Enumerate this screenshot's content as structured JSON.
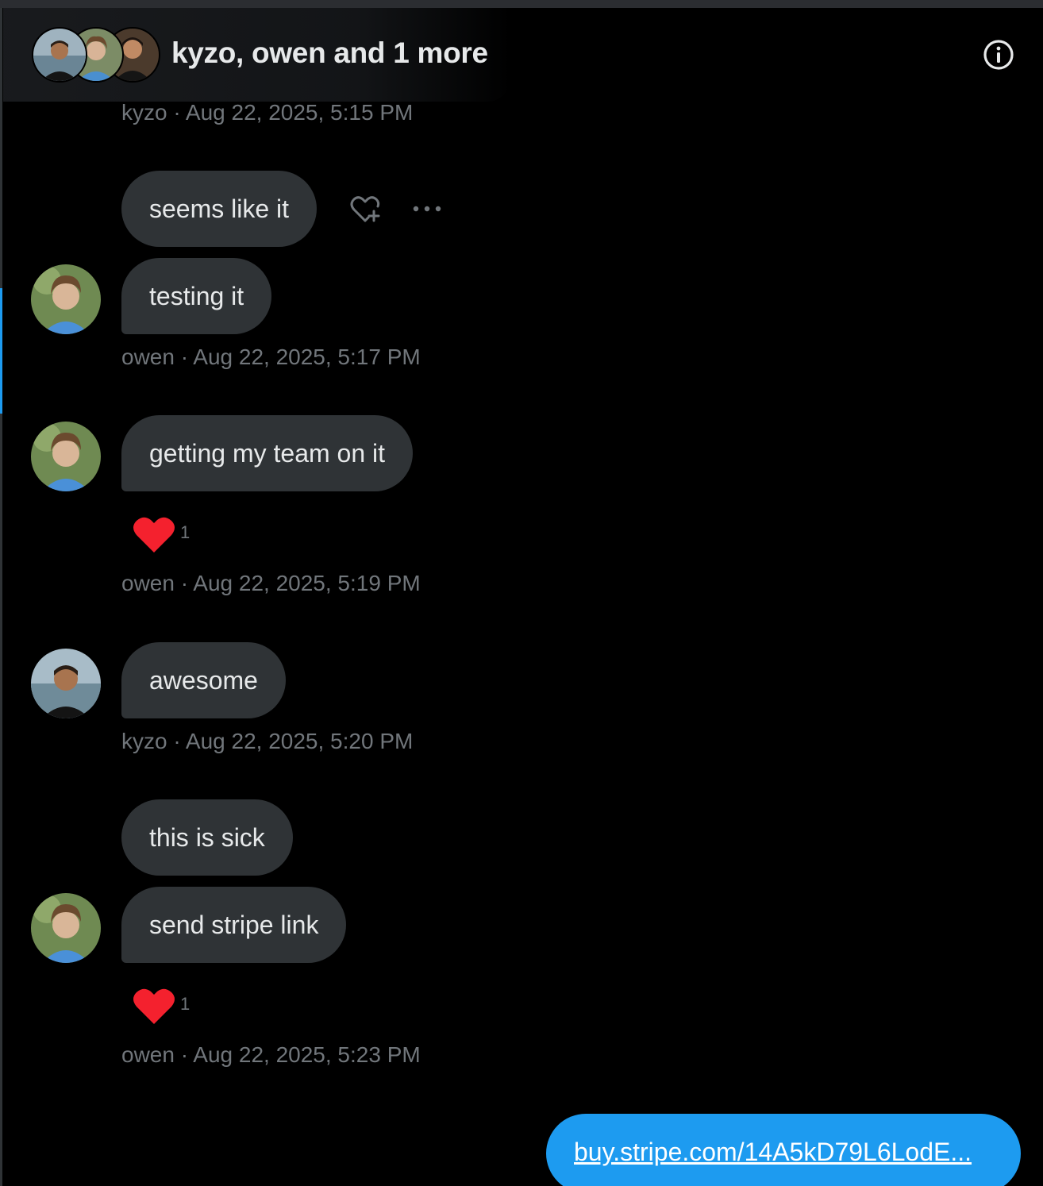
{
  "header": {
    "title": "kyzo, owen and 1 more"
  },
  "messages": [
    {
      "kind": "timestamp",
      "text": "kyzo · Aug 22, 2025, 5:15 PM"
    },
    {
      "kind": "bubble",
      "text": "seems like it"
    },
    {
      "kind": "bubble",
      "text": "testing it"
    },
    {
      "kind": "timestamp",
      "text": "owen · Aug 22, 2025, 5:17 PM"
    },
    {
      "kind": "bubble",
      "text": "getting my team on it"
    },
    {
      "kind": "reaction",
      "emoji": "heart",
      "count": "1"
    },
    {
      "kind": "timestamp",
      "text": "owen · Aug 22, 2025, 5:19 PM"
    },
    {
      "kind": "bubble",
      "text": "awesome"
    },
    {
      "kind": "timestamp",
      "text": "kyzo · Aug 22, 2025, 5:20 PM"
    },
    {
      "kind": "bubble",
      "text": "this is sick"
    },
    {
      "kind": "bubble",
      "text": "send stripe link"
    },
    {
      "kind": "reaction",
      "emoji": "heart",
      "count": "1"
    },
    {
      "kind": "timestamp",
      "text": "owen · Aug 22, 2025, 5:23 PM"
    },
    {
      "kind": "sent-link",
      "text": "buy.stripe.com/14A5kD79L6LodE..."
    }
  ],
  "colors": {
    "background": "#000000",
    "bubble": "#2f3336",
    "timestamp": "#71767b",
    "accent": "#1d9bf0",
    "heart": "#f4212e"
  },
  "icons": {
    "info": "info-circle-icon",
    "react": "heart-plus-icon",
    "more": "more-horizontal-icon",
    "reaction": "red-heart-icon"
  }
}
